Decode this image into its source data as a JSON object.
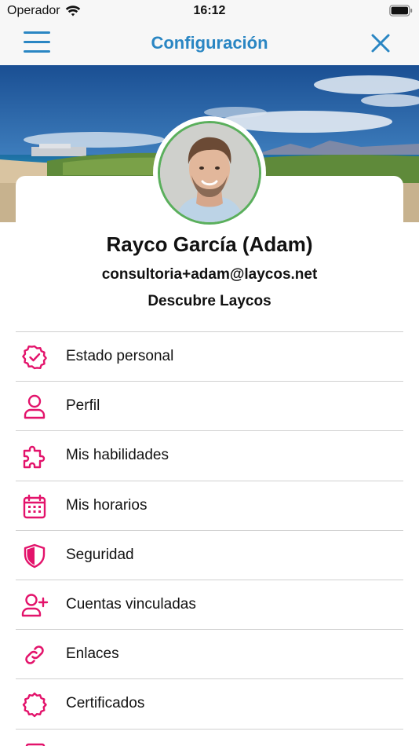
{
  "status_bar": {
    "carrier": "Operador",
    "time": "16:12"
  },
  "nav": {
    "title": "Configuración"
  },
  "profile": {
    "name": "Rayco García (Adam)",
    "email": "consultoria+adam@laycos.net",
    "organization": "Descubre Laycos"
  },
  "colors": {
    "accent": "#2a86c3",
    "icon_pink": "#e3136b",
    "avatar_ring": "#5aaf5c"
  },
  "menu": [
    {
      "label": "Estado personal",
      "icon": "badge-check-icon"
    },
    {
      "label": "Perfil",
      "icon": "user-icon"
    },
    {
      "label": "Mis habilidades",
      "icon": "puzzle-icon"
    },
    {
      "label": "Mis horarios",
      "icon": "calendar-icon"
    },
    {
      "label": "Seguridad",
      "icon": "shield-icon"
    },
    {
      "label": "Cuentas vinculadas",
      "icon": "user-plus-icon"
    },
    {
      "label": "Enlaces",
      "icon": "link-icon"
    },
    {
      "label": "Certificados",
      "icon": "certificate-icon"
    }
  ]
}
